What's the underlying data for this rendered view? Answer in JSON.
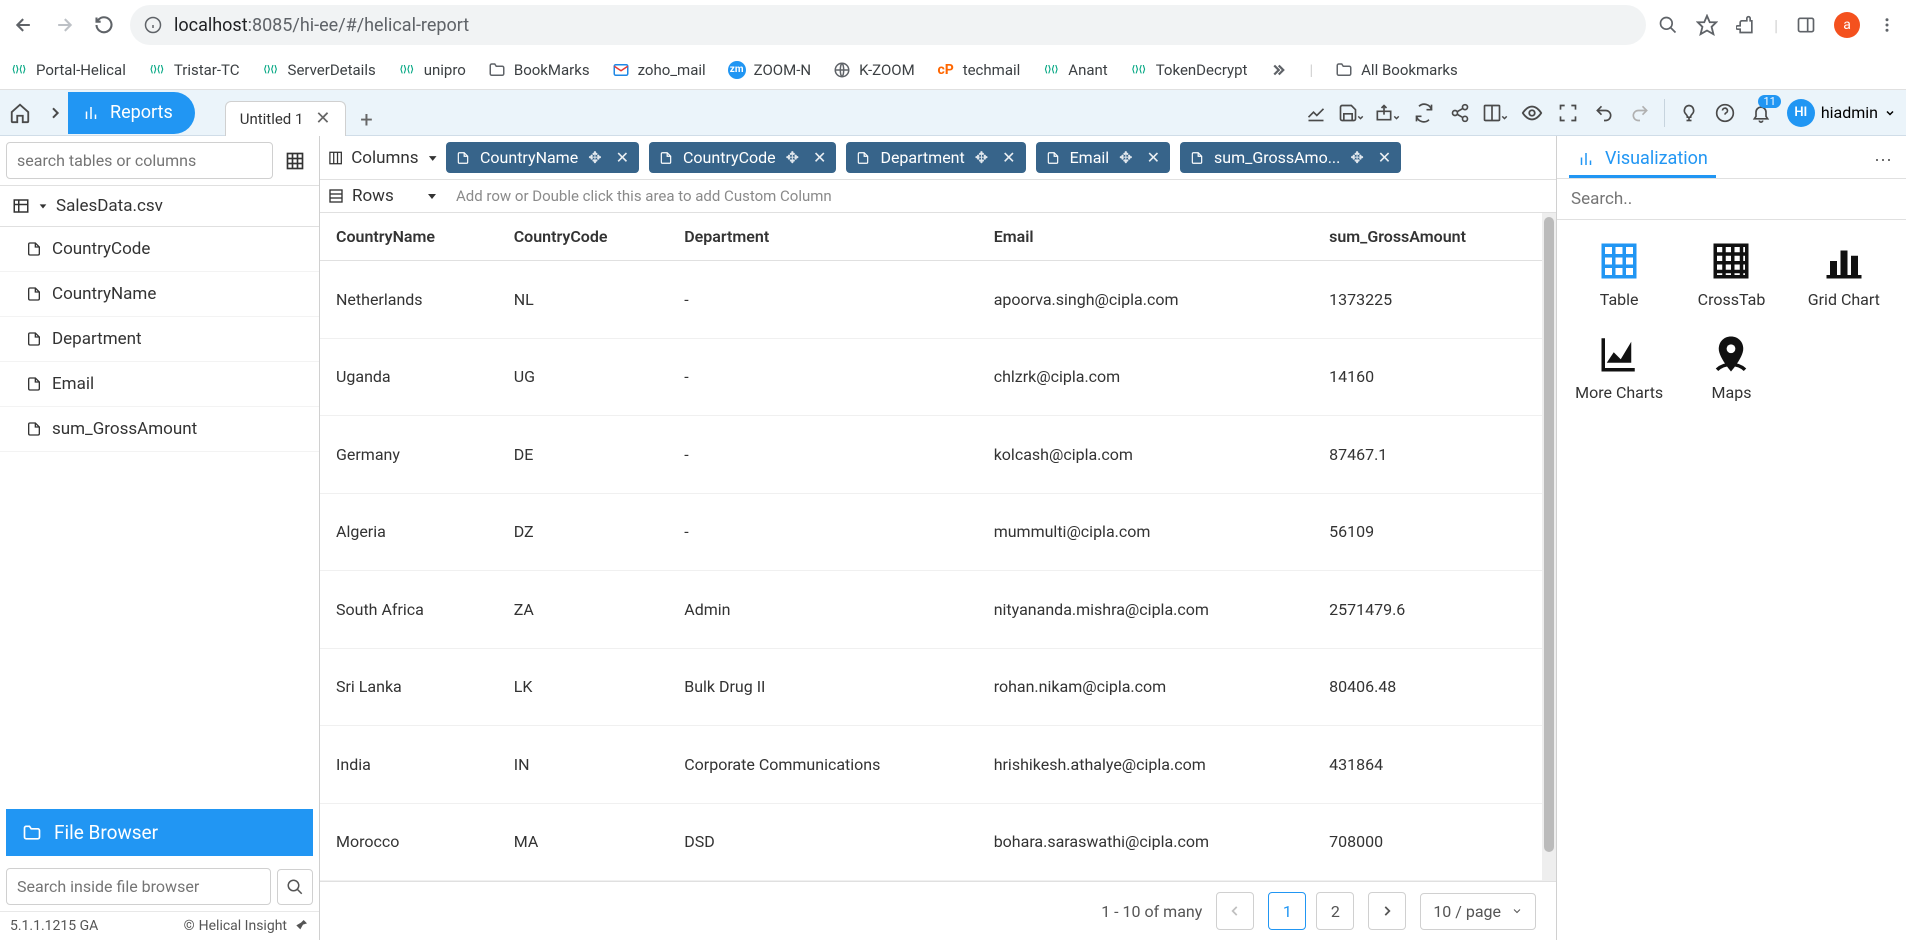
{
  "browser": {
    "url_prefix": "localhost",
    "url_rest": ":8085/hi-ee/#/helical-report",
    "avatar_letter": "a"
  },
  "bookmarks": [
    {
      "label": "Portal-Helical",
      "kind": "helical"
    },
    {
      "label": "Tristar-TC",
      "kind": "helical"
    },
    {
      "label": "ServerDetails",
      "kind": "helical"
    },
    {
      "label": "unipro",
      "kind": "helical"
    },
    {
      "label": "BookMarks",
      "kind": "folder"
    },
    {
      "label": "zoho_mail",
      "kind": "mail"
    },
    {
      "label": "ZOOM-N",
      "kind": "zm"
    },
    {
      "label": "K-ZOOM",
      "kind": "globe"
    },
    {
      "label": "techmail",
      "kind": "cp"
    },
    {
      "label": "Anant",
      "kind": "helical"
    },
    {
      "label": "TokenDecrypt",
      "kind": "helical"
    }
  ],
  "all_bookmarks_label": "All Bookmarks",
  "header": {
    "reports_label": "Reports",
    "tab_title": "Untitled 1",
    "notification_count": "11",
    "user_initials": "HI",
    "user_name": "hiadmin"
  },
  "sidebar": {
    "search_placeholder": "search tables or columns",
    "datasource": "SalesData.csv",
    "fields": [
      "CountryCode",
      "CountryName",
      "Department",
      "Email",
      "sum_GrossAmount"
    ],
    "file_browser_label": "File Browser",
    "fb_search_placeholder": "Search inside file browser",
    "version": "5.1.1.1215 GA",
    "copyright": "Helical Insight"
  },
  "shelves": {
    "columns_label": "Columns",
    "rows_label": "Rows",
    "row_placeholder": "Add row or Double click this area to add Custom Column",
    "chips": [
      "CountryName",
      "CountryCode",
      "Department",
      "Email",
      "sum_GrossAmo..."
    ]
  },
  "table": {
    "headers": [
      "CountryName",
      "CountryCode",
      "Department",
      "Email",
      "sum_GrossAmount"
    ],
    "rows": [
      [
        "Netherlands",
        "NL",
        "-",
        "apoorva.singh@cipla.com",
        "1373225"
      ],
      [
        "Uganda",
        "UG",
        "-",
        "chlzrk@cipla.com",
        "14160"
      ],
      [
        "Germany",
        "DE",
        "-",
        "kolcash@cipla.com",
        "87467.1"
      ],
      [
        "Algeria",
        "DZ",
        "-",
        "mummulti@cipla.com",
        "56109"
      ],
      [
        "South Africa",
        "ZA",
        "Admin",
        "nityananda.mishra@cipla.com",
        "2571479.6"
      ],
      [
        "Sri Lanka",
        "LK",
        "Bulk Drug II",
        "rohan.nikam@cipla.com",
        "80406.48"
      ],
      [
        "India",
        "IN",
        "Corporate Communications",
        "hrishikesh.athalye@cipla.com",
        "431864"
      ],
      [
        "Morocco",
        "MA",
        "DSD",
        "bohara.saraswathi@cipla.com",
        "708000"
      ]
    ]
  },
  "pagination": {
    "range_text": "1 - 10 of many",
    "pages": [
      "1",
      "2"
    ],
    "active_page": "1",
    "per_page": "10 / page"
  },
  "viz": {
    "tab_label": "Visualization",
    "search_placeholder": "Search..",
    "items": [
      "Table",
      "CrossTab",
      "Grid Chart",
      "More Charts",
      "Maps"
    ]
  }
}
